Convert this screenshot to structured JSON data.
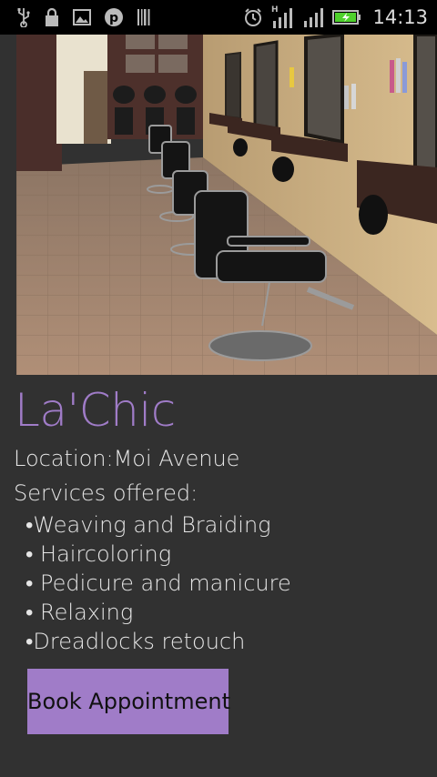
{
  "status_bar": {
    "time": "14:13",
    "network_type": "H",
    "icons": [
      "usb-icon",
      "lock-icon",
      "image-icon",
      "pinterest-icon",
      "barcode-icon",
      "alarm-icon",
      "signal-icon",
      "signal-icon",
      "battery-charging-icon"
    ]
  },
  "salon": {
    "name": "La'Chic",
    "location": "Location:Moi Avenue",
    "services_heading": "Services offered:",
    "services": [
      "•Weaving and Braiding",
      "• Haircoloring",
      "• Pedicure and manicure",
      "• Relaxing",
      "•Dreadlocks retouch"
    ]
  },
  "actions": {
    "book_label": "Book Appointment"
  },
  "colors": {
    "background": "#313131",
    "accent": "#a07cc8",
    "status_bar": "#000000",
    "battery": "#4fd12c"
  }
}
